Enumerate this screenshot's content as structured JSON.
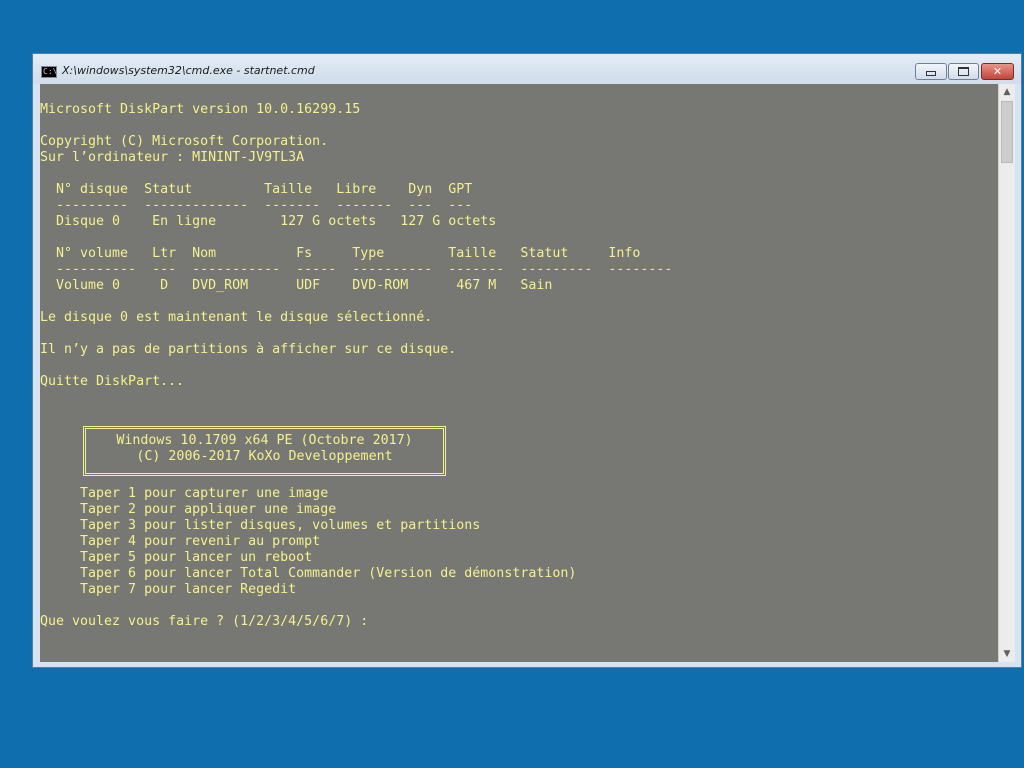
{
  "window": {
    "title": "X:\\windows\\system32\\cmd.exe - startnet.cmd",
    "icon": "cmd-icon",
    "icon_text": "C:\\",
    "buttons": {
      "minimize": "minimize-icon",
      "maximize": "maximize-icon",
      "close": "✕"
    }
  },
  "console": {
    "lines": [
      "",
      "Microsoft DiskPart version 10.0.16299.15",
      "",
      "Copyright (C) Microsoft Corporation.",
      "Sur l’ordinateur : MININT-JV9TL3A",
      "",
      "  N° disque  Statut         Taille   Libre    Dyn  GPT",
      "  ---------  -------------  -------  -------  ---  ---",
      "  Disque 0    En ligne        127 G octets   127 G octets",
      "",
      "  N° volume   Ltr  Nom          Fs     Type        Taille   Statut     Info",
      "  ----------  ---  -----------  -----  ----------  -------  ---------  --------",
      "  Volume 0     D   DVD_ROM      UDF    DVD-ROM      467 M   Sain",
      "",
      "Le disque 0 est maintenant le disque sélectionné.",
      "",
      "Il n’y a pas de partitions à afficher sur ce disque.",
      "",
      "Quitte DiskPart...",
      "",
      "",
      "",
      "",
      "",
      "",
      "     Taper 1 pour capturer une image",
      "     Taper 2 pour appliquer une image",
      "     Taper 3 pour lister disques, volumes et partitions",
      "     Taper 4 pour revenir au prompt",
      "     Taper 5 pour lancer un reboot",
      "     Taper 6 pour lancer Total Commander (Version de démonstration)",
      "     Taper 7 pour lancer Regedit",
      "",
      "Que voulez vous faire ? (1/2/3/4/5/6/7) :"
    ],
    "banner": {
      "line1": "Windows 10.1709 x64 PE (Octobre 2017)",
      "line2": "(C) 2006-2017 KoXo Developpement"
    },
    "colors": {
      "background": "#777774",
      "text": "#f4f18e"
    }
  },
  "desktop": {
    "background": "#0f6fae"
  },
  "scrollbar": {
    "up_arrow": "▲",
    "down_arrow": "▼"
  }
}
